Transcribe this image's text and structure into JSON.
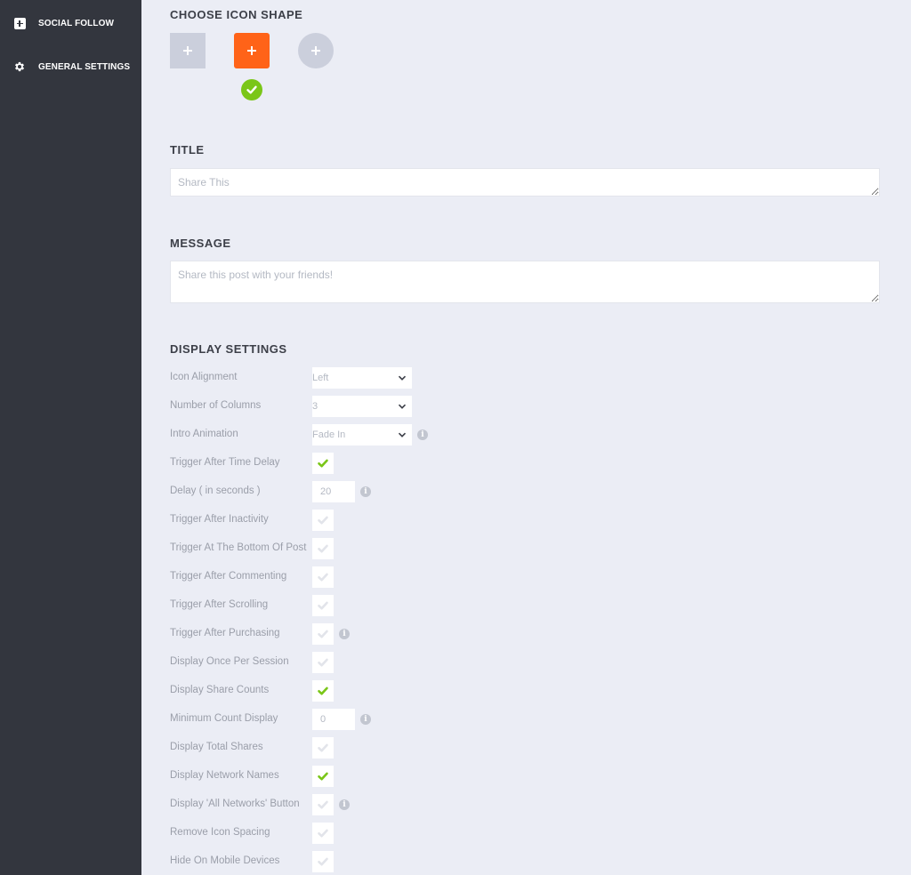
{
  "sidebar": {
    "items": [
      {
        "label": "SOCIAL FOLLOW",
        "icon": "plus-square-icon"
      },
      {
        "label": "GENERAL SETTINGS",
        "icon": "gear-icon"
      }
    ]
  },
  "icon_shape": {
    "title": "CHOOSE ICON SHAPE",
    "options": [
      "square",
      "rounded",
      "circle"
    ],
    "selected": "rounded",
    "accent_color": "#ff6318",
    "inactive_color": "#cbcfdc",
    "check_color": "#7ac618"
  },
  "title_section": {
    "heading": "TITLE",
    "placeholder": "Share This"
  },
  "message_section": {
    "heading": "MESSAGE",
    "placeholder": "Share this post with your friends!"
  },
  "display_settings": {
    "heading": "DISPLAY SETTINGS",
    "icon_alignment": {
      "label": "Icon Alignment",
      "value": "Left"
    },
    "number_of_columns": {
      "label": "Number of Columns",
      "value": "3"
    },
    "intro_animation": {
      "label": "Intro Animation",
      "value": "Fade In"
    },
    "delay": {
      "label": "Delay ( in seconds )",
      "value": "20"
    },
    "minimum_count": {
      "label": "Minimum Count Display",
      "value": "0"
    },
    "checkboxes": [
      {
        "label": "Trigger After Time Delay",
        "checked": true
      },
      {
        "label": "Trigger After Inactivity",
        "checked": false
      },
      {
        "label": "Trigger At The Bottom Of Post",
        "checked": false
      },
      {
        "label": "Trigger After Commenting",
        "checked": false
      },
      {
        "label": "Trigger After Scrolling",
        "checked": false
      },
      {
        "label": "Trigger After Purchasing",
        "checked": false
      },
      {
        "label": "Display Once Per Session",
        "checked": false
      },
      {
        "label": "Display Share Counts",
        "checked": true
      },
      {
        "label": "Display Total Shares",
        "checked": false
      },
      {
        "label": "Display Network Names",
        "checked": true
      },
      {
        "label": "Display 'All Networks' Button",
        "checked": false
      },
      {
        "label": "Remove Icon Spacing",
        "checked": false
      },
      {
        "label": "Hide On Mobile Devices",
        "checked": false
      }
    ]
  }
}
